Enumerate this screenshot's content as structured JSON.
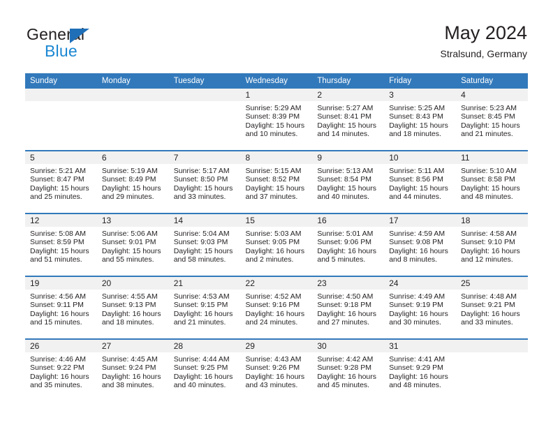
{
  "brand": {
    "word_top": "General",
    "word_bottom": "Blue",
    "triangle_color": "#1e6fb8",
    "blue_color": "#1b87d2"
  },
  "header": {
    "title": "May 2024",
    "subtitle": "Stralsund, Germany",
    "accent_color": "#3279bb",
    "daynum_band_color": "#f1f1f1"
  },
  "weekdays": [
    "Sunday",
    "Monday",
    "Tuesday",
    "Wednesday",
    "Thursday",
    "Friday",
    "Saturday"
  ],
  "labels": {
    "sunrise": "Sunrise:",
    "sunset": "Sunset:",
    "daylight": "Daylight:"
  },
  "weeks": [
    [
      {
        "day": "",
        "empty": true
      },
      {
        "day": "",
        "empty": true
      },
      {
        "day": "",
        "empty": true
      },
      {
        "day": "1",
        "sunrise": "Sunrise: 5:29 AM",
        "sunset": "Sunset: 8:39 PM",
        "daylight1": "Daylight: 15 hours",
        "daylight2": "and 10 minutes."
      },
      {
        "day": "2",
        "sunrise": "Sunrise: 5:27 AM",
        "sunset": "Sunset: 8:41 PM",
        "daylight1": "Daylight: 15 hours",
        "daylight2": "and 14 minutes."
      },
      {
        "day": "3",
        "sunrise": "Sunrise: 5:25 AM",
        "sunset": "Sunset: 8:43 PM",
        "daylight1": "Daylight: 15 hours",
        "daylight2": "and 18 minutes."
      },
      {
        "day": "4",
        "sunrise": "Sunrise: 5:23 AM",
        "sunset": "Sunset: 8:45 PM",
        "daylight1": "Daylight: 15 hours",
        "daylight2": "and 21 minutes."
      }
    ],
    [
      {
        "day": "5",
        "sunrise": "Sunrise: 5:21 AM",
        "sunset": "Sunset: 8:47 PM",
        "daylight1": "Daylight: 15 hours",
        "daylight2": "and 25 minutes."
      },
      {
        "day": "6",
        "sunrise": "Sunrise: 5:19 AM",
        "sunset": "Sunset: 8:49 PM",
        "daylight1": "Daylight: 15 hours",
        "daylight2": "and 29 minutes."
      },
      {
        "day": "7",
        "sunrise": "Sunrise: 5:17 AM",
        "sunset": "Sunset: 8:50 PM",
        "daylight1": "Daylight: 15 hours",
        "daylight2": "and 33 minutes."
      },
      {
        "day": "8",
        "sunrise": "Sunrise: 5:15 AM",
        "sunset": "Sunset: 8:52 PM",
        "daylight1": "Daylight: 15 hours",
        "daylight2": "and 37 minutes."
      },
      {
        "day": "9",
        "sunrise": "Sunrise: 5:13 AM",
        "sunset": "Sunset: 8:54 PM",
        "daylight1": "Daylight: 15 hours",
        "daylight2": "and 40 minutes."
      },
      {
        "day": "10",
        "sunrise": "Sunrise: 5:11 AM",
        "sunset": "Sunset: 8:56 PM",
        "daylight1": "Daylight: 15 hours",
        "daylight2": "and 44 minutes."
      },
      {
        "day": "11",
        "sunrise": "Sunrise: 5:10 AM",
        "sunset": "Sunset: 8:58 PM",
        "daylight1": "Daylight: 15 hours",
        "daylight2": "and 48 minutes."
      }
    ],
    [
      {
        "day": "12",
        "sunrise": "Sunrise: 5:08 AM",
        "sunset": "Sunset: 8:59 PM",
        "daylight1": "Daylight: 15 hours",
        "daylight2": "and 51 minutes."
      },
      {
        "day": "13",
        "sunrise": "Sunrise: 5:06 AM",
        "sunset": "Sunset: 9:01 PM",
        "daylight1": "Daylight: 15 hours",
        "daylight2": "and 55 minutes."
      },
      {
        "day": "14",
        "sunrise": "Sunrise: 5:04 AM",
        "sunset": "Sunset: 9:03 PM",
        "daylight1": "Daylight: 15 hours",
        "daylight2": "and 58 minutes."
      },
      {
        "day": "15",
        "sunrise": "Sunrise: 5:03 AM",
        "sunset": "Sunset: 9:05 PM",
        "daylight1": "Daylight: 16 hours",
        "daylight2": "and 2 minutes."
      },
      {
        "day": "16",
        "sunrise": "Sunrise: 5:01 AM",
        "sunset": "Sunset: 9:06 PM",
        "daylight1": "Daylight: 16 hours",
        "daylight2": "and 5 minutes."
      },
      {
        "day": "17",
        "sunrise": "Sunrise: 4:59 AM",
        "sunset": "Sunset: 9:08 PM",
        "daylight1": "Daylight: 16 hours",
        "daylight2": "and 8 minutes."
      },
      {
        "day": "18",
        "sunrise": "Sunrise: 4:58 AM",
        "sunset": "Sunset: 9:10 PM",
        "daylight1": "Daylight: 16 hours",
        "daylight2": "and 12 minutes."
      }
    ],
    [
      {
        "day": "19",
        "sunrise": "Sunrise: 4:56 AM",
        "sunset": "Sunset: 9:11 PM",
        "daylight1": "Daylight: 16 hours",
        "daylight2": "and 15 minutes."
      },
      {
        "day": "20",
        "sunrise": "Sunrise: 4:55 AM",
        "sunset": "Sunset: 9:13 PM",
        "daylight1": "Daylight: 16 hours",
        "daylight2": "and 18 minutes."
      },
      {
        "day": "21",
        "sunrise": "Sunrise: 4:53 AM",
        "sunset": "Sunset: 9:15 PM",
        "daylight1": "Daylight: 16 hours",
        "daylight2": "and 21 minutes."
      },
      {
        "day": "22",
        "sunrise": "Sunrise: 4:52 AM",
        "sunset": "Sunset: 9:16 PM",
        "daylight1": "Daylight: 16 hours",
        "daylight2": "and 24 minutes."
      },
      {
        "day": "23",
        "sunrise": "Sunrise: 4:50 AM",
        "sunset": "Sunset: 9:18 PM",
        "daylight1": "Daylight: 16 hours",
        "daylight2": "and 27 minutes."
      },
      {
        "day": "24",
        "sunrise": "Sunrise: 4:49 AM",
        "sunset": "Sunset: 9:19 PM",
        "daylight1": "Daylight: 16 hours",
        "daylight2": "and 30 minutes."
      },
      {
        "day": "25",
        "sunrise": "Sunrise: 4:48 AM",
        "sunset": "Sunset: 9:21 PM",
        "daylight1": "Daylight: 16 hours",
        "daylight2": "and 33 minutes."
      }
    ],
    [
      {
        "day": "26",
        "sunrise": "Sunrise: 4:46 AM",
        "sunset": "Sunset: 9:22 PM",
        "daylight1": "Daylight: 16 hours",
        "daylight2": "and 35 minutes."
      },
      {
        "day": "27",
        "sunrise": "Sunrise: 4:45 AM",
        "sunset": "Sunset: 9:24 PM",
        "daylight1": "Daylight: 16 hours",
        "daylight2": "and 38 minutes."
      },
      {
        "day": "28",
        "sunrise": "Sunrise: 4:44 AM",
        "sunset": "Sunset: 9:25 PM",
        "daylight1": "Daylight: 16 hours",
        "daylight2": "and 40 minutes."
      },
      {
        "day": "29",
        "sunrise": "Sunrise: 4:43 AM",
        "sunset": "Sunset: 9:26 PM",
        "daylight1": "Daylight: 16 hours",
        "daylight2": "and 43 minutes."
      },
      {
        "day": "30",
        "sunrise": "Sunrise: 4:42 AM",
        "sunset": "Sunset: 9:28 PM",
        "daylight1": "Daylight: 16 hours",
        "daylight2": "and 45 minutes."
      },
      {
        "day": "31",
        "sunrise": "Sunrise: 4:41 AM",
        "sunset": "Sunset: 9:29 PM",
        "daylight1": "Daylight: 16 hours",
        "daylight2": "and 48 minutes."
      },
      {
        "day": "",
        "empty": true
      }
    ]
  ]
}
